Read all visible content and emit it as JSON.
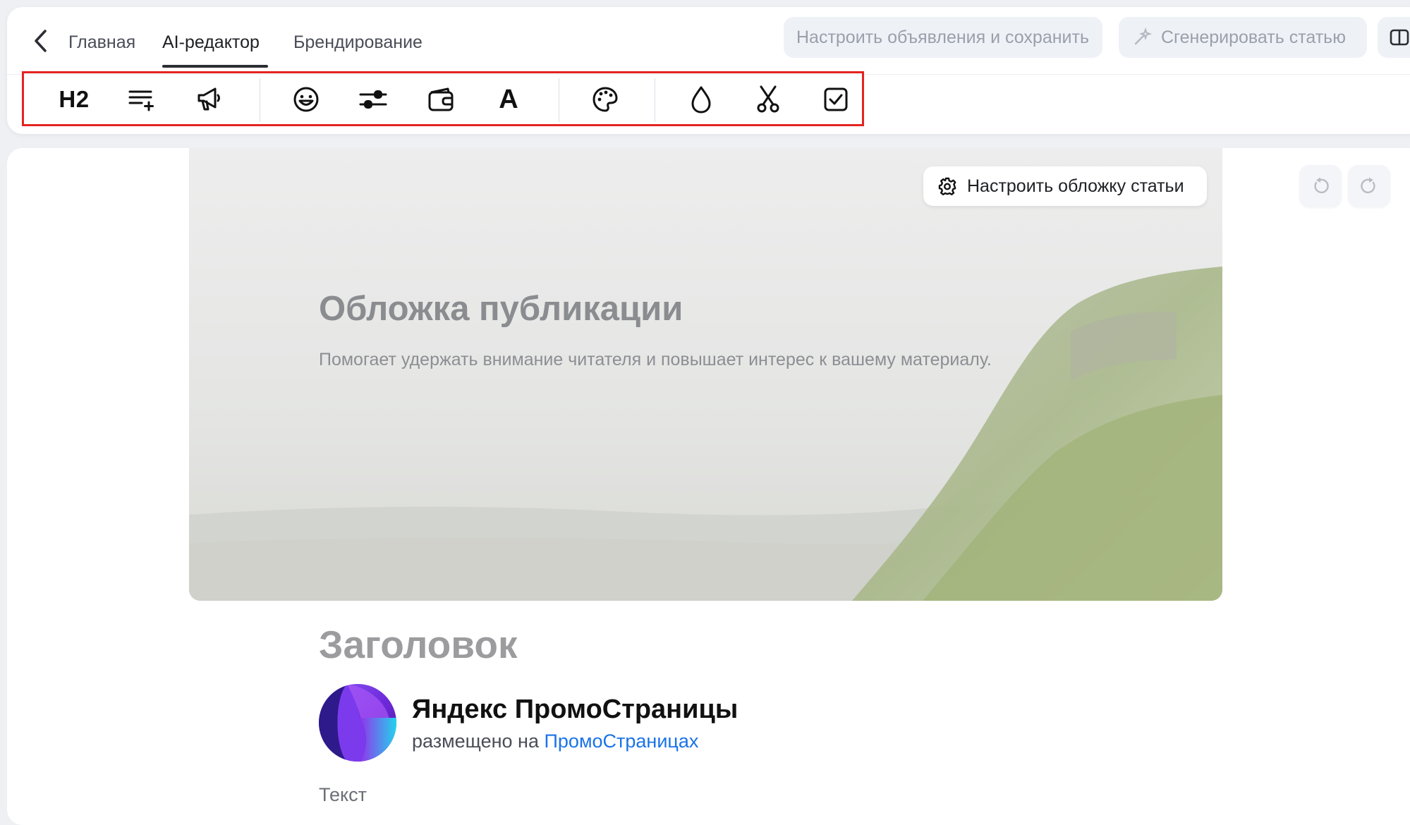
{
  "header": {
    "tabs": [
      {
        "label": "Главная",
        "active": false
      },
      {
        "label": "AI-редактор",
        "active": true
      },
      {
        "label": "Брендирование",
        "active": false
      }
    ],
    "buttons": {
      "configure_ads": "Настроить объявления и сохранить",
      "generate_article": "Сгенерировать статью"
    },
    "icons": {
      "back": "chevron-left-icon",
      "generate": "sparkle-icon",
      "panel": "sidebar-panel-icon"
    }
  },
  "toolbar": {
    "h2_label": "H2",
    "font_label": "A",
    "tools": [
      "heading-h2",
      "add-paragraph-icon",
      "megaphone-icon",
      "emoji-icon",
      "sliders-icon",
      "wallet-icon",
      "font-icon",
      "palette-icon",
      "droplet-icon",
      "scissors-icon",
      "checkbox-icon"
    ],
    "highlight_color": "#e52320"
  },
  "cover": {
    "configure_label": "Настроить обложку статьи",
    "title": "Обложка публикации",
    "subtitle": "Помогает удержать внимание читателя и повышает интерес к вашему материалу."
  },
  "article": {
    "title": "Заголовок",
    "author_name": "Яндекс ПромоСтраницы",
    "posted_prefix": "размещено на",
    "posted_link": "ПромоСтраницах",
    "body_placeholder": "Текст"
  },
  "colors": {
    "link": "#1a73e8",
    "page_bg": "#eef0f4"
  }
}
